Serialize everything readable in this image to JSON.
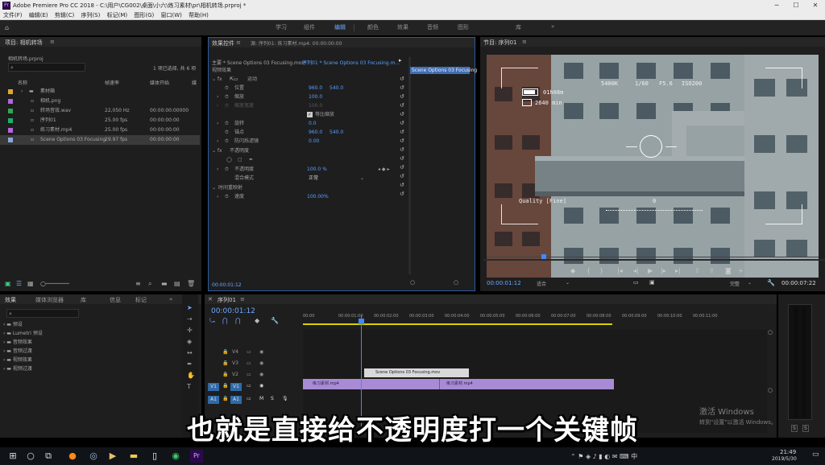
{
  "window": {
    "title": "Adobe Premiere Pro CC 2018 - C:\\用户\\CG002\\桌面\\小六\\练习素材\\pr\\相机转场.prproj *",
    "minimize": "─",
    "maximize": "☐",
    "close": "✕"
  },
  "menu": [
    "文件(F)",
    "编辑(E)",
    "剪辑(C)",
    "序列(S)",
    "标记(M)",
    "图形(G)",
    "窗口(W)",
    "帮助(H)"
  ],
  "workspaces": [
    "学习",
    "组件",
    "编辑",
    "颜色",
    "效果",
    "音频",
    "图形",
    "库"
  ],
  "workspace_active": "编辑",
  "workspace_more": "»",
  "project": {
    "tab": "项目: 相机转场",
    "tab_menu": "≡",
    "file": "相机转场.prproj",
    "selected_count": "1 项已选择, 共 6 项",
    "columns": {
      "name": "名称",
      "fps": "帧速率",
      "start": "媒体开始",
      "more": "媒"
    },
    "items": [
      {
        "name": "素材箱",
        "fps": "",
        "start": "",
        "color": "#e0a830",
        "folder": true
      },
      {
        "name": "相机.png",
        "fps": "",
        "start": "",
        "color": "#b565d9"
      },
      {
        "name": "转场音效.wav",
        "fps": "22,050 Hz",
        "start": "00:00:00:00000",
        "color": "#2fa84f"
      },
      {
        "name": "序列01",
        "fps": "25.00 fps",
        "start": "00:00:00:00",
        "color": "#1fae6a"
      },
      {
        "name": "练习素材.mp4",
        "fps": "25.00 fps",
        "start": "00:00:00:00",
        "color": "#b565d9"
      },
      {
        "name": "Scene Options 03 Focusing",
        "fps": "29.97 fps",
        "start": "00:00:00:00",
        "color": "#8aa7d9",
        "selected": true
      }
    ]
  },
  "effect_controls": {
    "tabs": [
      "效果控件",
      "源: 序列01: 练习素材.mp4: 00:00:00:00"
    ],
    "tab_menu": "≡",
    "master": "主要 * Scene Options 03 Focusing.mov",
    "sequence": "序列01 * Scene Options 03 Focusing.m...",
    "clip_label": "Scene Options 03 Focusing",
    "video_fx": "视频效果",
    "motion": "运动",
    "position": {
      "label": "位置",
      "x": "960.0",
      "y": "540.0"
    },
    "scale": {
      "label": "缩放",
      "v": "100.0"
    },
    "scale_width": {
      "label": "缩放宽度",
      "v": "100.0"
    },
    "uniform": "等比缩放",
    "rotation": {
      "label": "旋转",
      "v": "0.0"
    },
    "anchor": {
      "label": "锚点",
      "x": "960.0",
      "y": "540.0"
    },
    "flicker": {
      "label": "防闪烁滤镜",
      "v": "0.00"
    },
    "opacity_section": "不透明度",
    "opacity": {
      "label": "不透明度",
      "v": "100.0 %"
    },
    "blend": {
      "label": "混合模式",
      "v": "正常"
    },
    "time_remap": "时间重映射",
    "speed": {
      "label": "速度",
      "v": "100.00%"
    },
    "timecode": "00:00:01:12"
  },
  "program": {
    "tab": "节目: 序列01",
    "tab_menu": "≡",
    "hud": {
      "wb": "5400K",
      "shutter": "1/60",
      "aperture": "F5.6",
      "iso": "ISO200",
      "battery": "01h08m",
      "storage": "2640 min",
      "quality": "Quality [Fine]",
      "zero": "0"
    },
    "timecode": "00:00:01:12",
    "fit": "适合",
    "quality": "完整",
    "duration": "00:00:07:22"
  },
  "effects_browser": {
    "tabs": [
      "效果",
      "媒体浏览器",
      "库",
      "信息",
      "标记"
    ],
    "tab_menu": "»",
    "items": [
      "预设",
      "Lumetri 预设",
      "音频效果",
      "音频过渡",
      "视频效果",
      "视频过渡"
    ]
  },
  "timeline": {
    "tab": "序列01",
    "tab_menu": "≡",
    "timecode": "00:00:01:12",
    "ruler": [
      "00:00",
      "00:00:01:00",
      "00:00:02:00",
      "00:00:03:00",
      "00:00:04:00",
      "00:00:05:00",
      "00:00:06:00",
      "00:00:07:00",
      "00:00:08:00",
      "00:00:09:00",
      "00:00:10:00",
      "00:00:11:00"
    ],
    "tracks": [
      "V4",
      "V3",
      "V2",
      "V1",
      "A1"
    ],
    "track_side": "V1",
    "audio_side": "A1",
    "clips": {
      "v2": "Scene Options 03 Focusing.mov",
      "v1a": "练习素材.mp4",
      "v1b": "练习素材.mp4"
    }
  },
  "meter": {
    "s1": "S",
    "s2": "S"
  },
  "subtitle": "也就是直接给不透明度打一个关键帧",
  "watermark": {
    "line1": "激活 Windows",
    "line2": "转到\"设置\"以激活 Windows。"
  },
  "taskbar": {
    "time": "21:49",
    "date": "2019/5/30"
  },
  "colors": {
    "accent": "#6ea7ff",
    "clip_purple": "#a88bd6",
    "playhead": "#3d8bff"
  }
}
